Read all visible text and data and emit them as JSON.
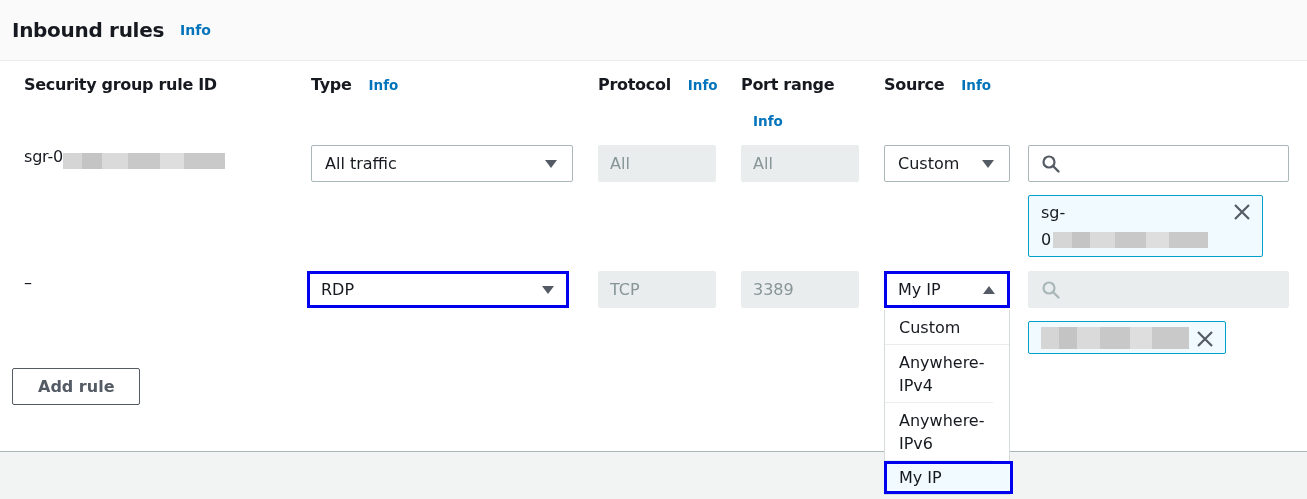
{
  "panel": {
    "title": "Inbound rules",
    "info_link": "Info"
  },
  "columns": [
    {
      "label": "Security group rule ID"
    },
    {
      "label": "Type",
      "info_link": "Info"
    },
    {
      "label": "Protocol",
      "info_link": "Info"
    },
    {
      "label": "Port range",
      "info_link": "Info"
    },
    {
      "label": "Source",
      "info_link": "Info"
    }
  ],
  "rules": [
    {
      "rule_id": "sgr-0",
      "rule_id_redacted": true,
      "type": "All traffic",
      "type_focused": false,
      "protocol": "All",
      "port_range": "All",
      "source": "Custom",
      "source_focused": false,
      "source_expanded": false,
      "search_disabled": false,
      "token_lines": [
        "sg-",
        "0"
      ]
    },
    {
      "rule_id": "–",
      "rule_id_redacted": false,
      "type": "RDP",
      "type_focused": true,
      "protocol": "TCP",
      "port_range": "3389",
      "source": "My IP",
      "source_focused": true,
      "source_expanded": true,
      "search_disabled": true,
      "source_options": [
        {
          "label": "Custom",
          "selected": false
        },
        {
          "label": "Anywhere-IPv4",
          "selected": false
        },
        {
          "label": "Anywhere-IPv6",
          "selected": false
        },
        {
          "label": "My IP",
          "selected": true
        }
      ]
    }
  ],
  "add_button": "Add rule"
}
